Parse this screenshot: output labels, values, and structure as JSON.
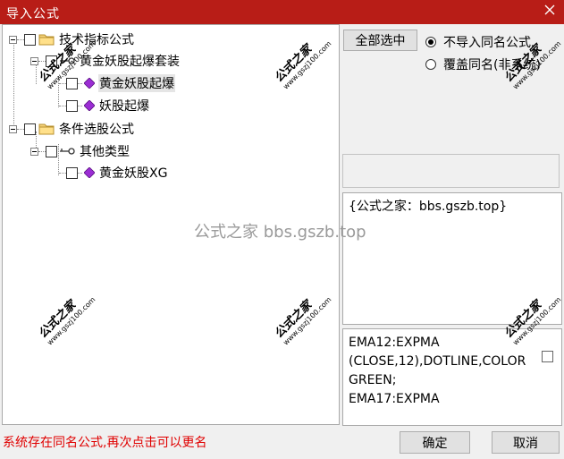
{
  "window": {
    "title": "导入公式",
    "close_icon": "close-icon"
  },
  "tree": {
    "groups": [
      {
        "label": "技术指标公式",
        "subgroup": {
          "label": "黄金妖股起爆套装"
        },
        "items": [
          "黄金妖股起爆",
          "妖股起爆"
        ]
      },
      {
        "label": "条件选股公式",
        "subgroup": {
          "label": "其他类型"
        },
        "items": [
          "黄金妖股XG"
        ]
      }
    ]
  },
  "options": {
    "select_all_label": "全部选中",
    "radio_skip_label": "不导入同名公式",
    "radio_overwrite_label": "覆盖同名(非系统)",
    "selected": "skip"
  },
  "description": {
    "text": "{公式之家：bbs.gszb.top}"
  },
  "code": {
    "text": "EMA12:EXPMA\n(CLOSE,12),DOTLINE,COLOR\nGREEN;\nEMA17:EXPMA"
  },
  "status_text": "系统存在同名公式,再次点击可以更名",
  "buttons": {
    "ok": "确定",
    "cancel": "取消"
  },
  "watermark": {
    "brand": "公式之家",
    "url": "www.gszj100.com",
    "center_text": "公式之家 bbs.gszb.top"
  },
  "colors": {
    "title_bar": "#b81d17",
    "status": "#e00000",
    "gem": "#9b2dd4"
  }
}
